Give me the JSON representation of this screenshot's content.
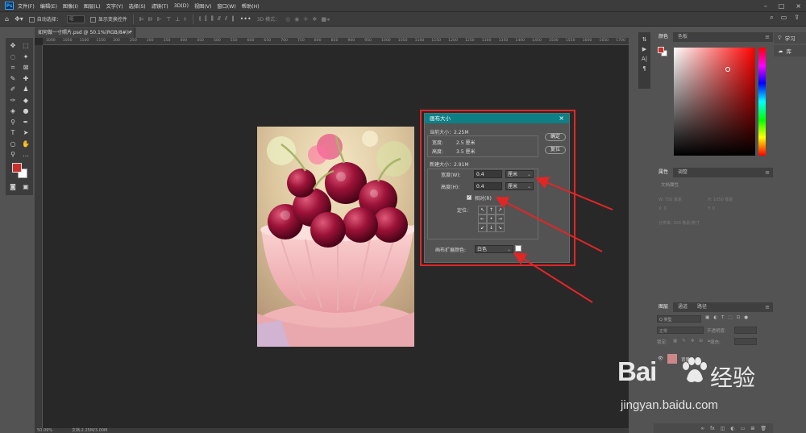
{
  "app": {
    "logo_text": "Ps"
  },
  "menu": [
    "文件(F)",
    "编辑(E)",
    "图像(I)",
    "图层(L)",
    "文字(Y)",
    "选择(S)",
    "滤镜(T)",
    "3D(D)",
    "视图(V)",
    "窗口(W)",
    "帮助(H)"
  ],
  "options_bar": {
    "auto_select_label": "自动选择：",
    "auto_select_value": "组",
    "show_transform_label": "显示变换控件",
    "mode_3d_label": "3D 模式："
  },
  "document_tab": {
    "title": "如何做一寸照片.psd @ 50.1%(RGB/8#) *",
    "close": "×"
  },
  "ruler_ticks": [
    "1000",
    "1050",
    "1100",
    "1150",
    "200",
    "250",
    "300",
    "350",
    "400",
    "450",
    "500",
    "550",
    "600",
    "650",
    "700",
    "750",
    "800",
    "850",
    "900",
    "950",
    "1000",
    "1050",
    "1100",
    "1150",
    "1200",
    "1250",
    "1300",
    "1350",
    "1400",
    "1450",
    "1500",
    "1550",
    "1600",
    "1650",
    "1700"
  ],
  "status_bar": {
    "zoom": "50.09%",
    "doc": "文档:2.25M/3.00M"
  },
  "dialog": {
    "title": "画布大小",
    "current_size_label": "当前大小：2.25M",
    "current_width_label": "宽度:",
    "current_width_value": "2.5 厘米",
    "current_height_label": "高度:",
    "current_height_value": "3.5 厘米",
    "new_size_label": "新建大小：2.91M",
    "width_label": "宽度(W):",
    "width_value": "0.4",
    "width_unit": "厘米",
    "height_label": "高度(H):",
    "height_value": "0.4",
    "height_unit": "厘米",
    "relative_label": "相对(R)",
    "relative_checked": true,
    "anchor_label": "定位:",
    "anchor_arrows": [
      "↖",
      "↑",
      "↗",
      "←",
      "•",
      "→",
      "↙",
      "↓",
      "↘"
    ],
    "ext_color_label": "画布扩展颜色:",
    "ext_color_value": "白色",
    "ok_label": "确定",
    "reset_label": "复位"
  },
  "panels": {
    "color_tabs": [
      "颜色",
      "色板"
    ],
    "props_tabs": [
      "属性",
      "调整"
    ],
    "props_sub": "文档属性",
    "props_rows": [
      "W: 750 像素",
      "H: 1050 像素",
      "X: 0",
      "Y: 0",
      "分辨率: 300 像素/英寸"
    ],
    "layers_tabs": [
      "图层",
      "通道",
      "路径"
    ],
    "layers_kind": "Q 类型",
    "layers_mode": "正常",
    "layers_opacity_label": "不透明度:",
    "layers_fill_label": "填充:",
    "layers_lock_label": "锁定:",
    "layer_name": "背景"
  },
  "far_panel": {
    "learn": "学习",
    "library": "库"
  },
  "watermark": {
    "brand": "Bai",
    "suffix": "经验",
    "url": "jingyan.baidu.com"
  },
  "colors": {
    "accent_dialog": "#0f7f86",
    "highlight": "#e32525",
    "foreground": "#c9302c"
  }
}
